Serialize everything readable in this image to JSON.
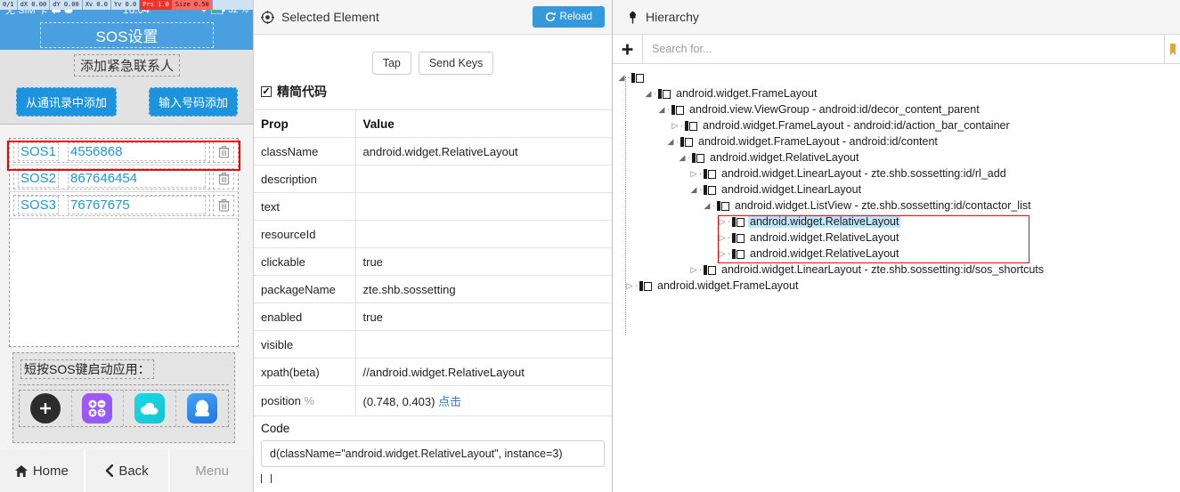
{
  "device": {
    "debug_overlay": [
      {
        "text": "0/1",
        "style": "normal"
      },
      {
        "text": "dX 0.00",
        "style": "normal"
      },
      {
        "text": "dY 0.00",
        "style": "normal"
      },
      {
        "text": "Xv 0.0",
        "style": "normal"
      },
      {
        "text": "Yv 0.0",
        "style": "normal"
      },
      {
        "text": "Prs 1.0",
        "style": "hl-red"
      },
      {
        "text": "Size 0.50",
        "style": "hl-red2"
      }
    ],
    "status_bar": {
      "carrier": "无 SIM 卡",
      "time": "16:04",
      "battery": "32 %"
    },
    "app_title": "SOS设置",
    "section_heading": "添加紧急联系人",
    "buttons": {
      "from_contacts": "从通讯录中添加",
      "enter_number": "输入号码添加"
    },
    "contacts": [
      {
        "label": "SOS1",
        "number": "4556868",
        "selected": true
      },
      {
        "label": "SOS2",
        "number": "867646454",
        "selected": false
      },
      {
        "label": "SOS3",
        "number": "76767675",
        "selected": false
      }
    ],
    "delete_icon": "trash-icon",
    "shortcuts": {
      "title": "短按SOS键启动应用：",
      "items": [
        {
          "name": "add-shortcut-icon",
          "kind": "plus"
        },
        {
          "name": "calculator-icon",
          "kind": "calc"
        },
        {
          "name": "cloud-icon",
          "kind": "cloud"
        },
        {
          "name": "qq-icon",
          "kind": "qq"
        }
      ]
    },
    "navbar": [
      {
        "label": "Home",
        "icon": "home-icon",
        "dim": false
      },
      {
        "label": "Back",
        "icon": "chevron-left-icon",
        "dim": false
      },
      {
        "label": "Menu",
        "icon": "",
        "dim": true
      }
    ]
  },
  "inspector": {
    "title": "Selected Element",
    "title_icon": "target-icon",
    "reload_label": "Reload",
    "reload_icon": "refresh-icon",
    "actions": [
      {
        "label": "Tap"
      },
      {
        "label": "Send Keys"
      }
    ],
    "simplify_label": "精简代码",
    "simplify_checked": true,
    "table": {
      "headers": [
        "Prop",
        "Value"
      ],
      "rows": [
        {
          "prop": "className",
          "value": "android.widget.RelativeLayout"
        },
        {
          "prop": "description",
          "value": ""
        },
        {
          "prop": "text",
          "value": ""
        },
        {
          "prop": "resourceId",
          "value": ""
        },
        {
          "prop": "clickable",
          "value": "true"
        },
        {
          "prop": "packageName",
          "value": "zte.shb.sossetting"
        },
        {
          "prop": "enabled",
          "value": "true"
        },
        {
          "prop": "visible",
          "value": ""
        },
        {
          "prop": "xpath(beta)",
          "value": "//android.widget.RelativeLayout"
        },
        {
          "prop": "position",
          "prop_suffix": "%",
          "value": "(0.748, 0.403)",
          "link": "点击"
        }
      ]
    },
    "code_label": "Code",
    "code_value": "d(className=\"android.widget.RelativeLayout\", instance=3)"
  },
  "hierarchy": {
    "title": "Hierarchy",
    "title_icon": "tree-icon",
    "add_icon": "plus-icon",
    "search_placeholder": "Search for...",
    "search_value": "",
    "nodes": [
      {
        "depth": 0,
        "label": "",
        "twist": "expanded",
        "selected": false
      },
      {
        "depth": 1,
        "label": "android.widget.FrameLayout",
        "twist": "expanded",
        "selected": false
      },
      {
        "depth": 2,
        "label": "android.view.ViewGroup - android:id/decor_content_parent",
        "twist": "expanded",
        "selected": false
      },
      {
        "depth": 3,
        "label": "android.widget.FrameLayout - android:id/action_bar_container",
        "twist": "collapsed",
        "selected": false
      },
      {
        "depth": 3,
        "label": "android.widget.FrameLayout - android:id/content",
        "twist": "expanded",
        "selected": false
      },
      {
        "depth": 4,
        "label": "android.widget.RelativeLayout",
        "twist": "expanded",
        "selected": false
      },
      {
        "depth": 5,
        "label": "android.widget.LinearLayout - zte.shb.sossetting:id/rl_add",
        "twist": "collapsed",
        "selected": false
      },
      {
        "depth": 5,
        "label": "android.widget.LinearLayout",
        "twist": "expanded",
        "selected": false
      },
      {
        "depth": 6,
        "label": "android.widget.ListView - zte.shb.sossetting:id/contactor_list",
        "twist": "expanded",
        "selected": false
      },
      {
        "depth": 7,
        "label": "android.widget.RelativeLayout",
        "twist": "collapsed",
        "selected": true
      },
      {
        "depth": 7,
        "label": "android.widget.RelativeLayout",
        "twist": "collapsed",
        "selected": false
      },
      {
        "depth": 7,
        "label": "android.widget.RelativeLayout",
        "twist": "collapsed",
        "selected": false
      },
      {
        "depth": 5,
        "label": "android.widget.LinearLayout - zte.shb.sossetting:id/sos_shortcuts",
        "twist": "collapsed",
        "selected": false
      },
      {
        "depth": 1,
        "label": "android.widget.FrameLayout",
        "twist": "collapsed",
        "selected": false
      }
    ]
  },
  "colors": {
    "android_blue": "#4a9fe0",
    "button_blue": "#1e93dd",
    "accent_blue": "#3498db",
    "selection_blue": "#bfe5fb",
    "highlight_red": "#ff0000",
    "link_blue": "#2d7fd3"
  }
}
